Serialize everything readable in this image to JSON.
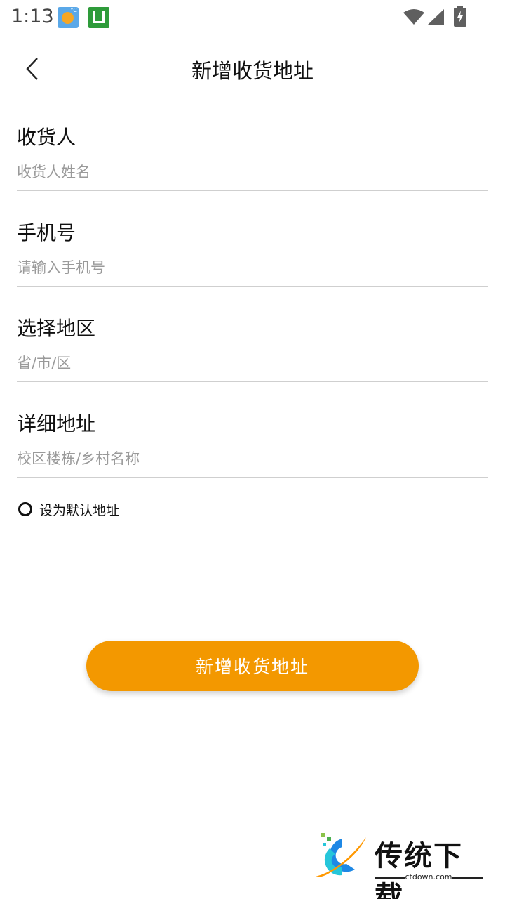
{
  "status_bar": {
    "time": "1:13",
    "icons": [
      "weather-icon",
      "app-icon",
      "wifi-icon",
      "signal-icon",
      "battery-charging-icon"
    ]
  },
  "nav": {
    "back_icon": "chevron-left-icon",
    "title": "新增收货地址"
  },
  "form": {
    "fields": [
      {
        "label": "收货人",
        "placeholder": "收货人姓名",
        "value": ""
      },
      {
        "label": "手机号",
        "placeholder": "请输入手机号",
        "value": ""
      },
      {
        "label": "选择地区",
        "placeholder": "省/市/区",
        "value": ""
      },
      {
        "label": "详细地址",
        "placeholder": "校区楼栋/乡村名称",
        "value": ""
      }
    ],
    "default_label": "设为默认地址",
    "default_checked": false
  },
  "submit": {
    "label": "新增收货地址"
  },
  "colors": {
    "accent": "#f39800",
    "divider": "#cfcfcf",
    "placeholder": "#9a9a9a"
  },
  "watermark": {
    "title": "传统下载",
    "url": "ctdown.com"
  }
}
